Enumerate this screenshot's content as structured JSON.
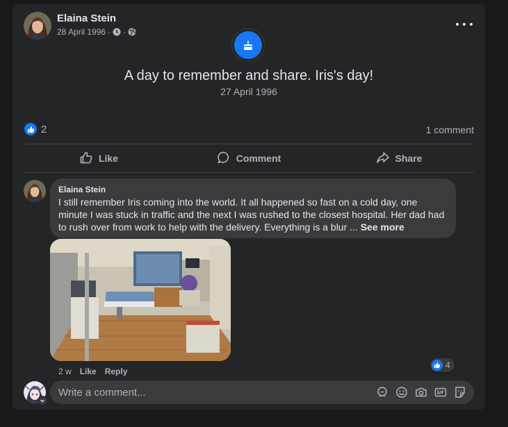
{
  "post": {
    "author": "Elaina Stein",
    "date": "28 April 1996",
    "separator": "·",
    "event_title": "A day to remember and share. Iris's day!",
    "event_date": "27 April 1996",
    "reaction_count": "2",
    "comment_count_label": "1 comment"
  },
  "actions": {
    "like": "Like",
    "comment": "Comment",
    "share": "Share"
  },
  "comment": {
    "author": "Elaina Stein",
    "text": "I still remember Iris coming into the world. It all happened so fast on a cold day, one minute I was stuck in traffic and the next I was rushed to the closest hospital. Her dad had to rush over from work to help with the delivery. Everything is a blur ... ",
    "see_more": "See more",
    "age": "2 w",
    "like": "Like",
    "reply": "Reply",
    "reaction_count": "4"
  },
  "composer": {
    "placeholder": "Write a comment..."
  },
  "colors": {
    "background": "#18191a",
    "card": "#242526",
    "bubble": "#3a3b3c",
    "accent": "#1877f2",
    "text_primary": "#e4e6eb",
    "text_secondary": "#b0b3b8"
  },
  "icons": {
    "event": "calendar-cake-icon",
    "clock": "clock-icon",
    "audience": "globe-icon",
    "more": "more-dots-icon",
    "like": "thumbs-up-icon",
    "comment": "speech-bubble-icon",
    "share": "share-arrow-icon",
    "composer_avatar_sticker": "avatar-sticker-icon",
    "emoji": "smiley-icon",
    "camera": "camera-icon",
    "gif": "gif-icon",
    "sticker": "sticker-icon"
  }
}
